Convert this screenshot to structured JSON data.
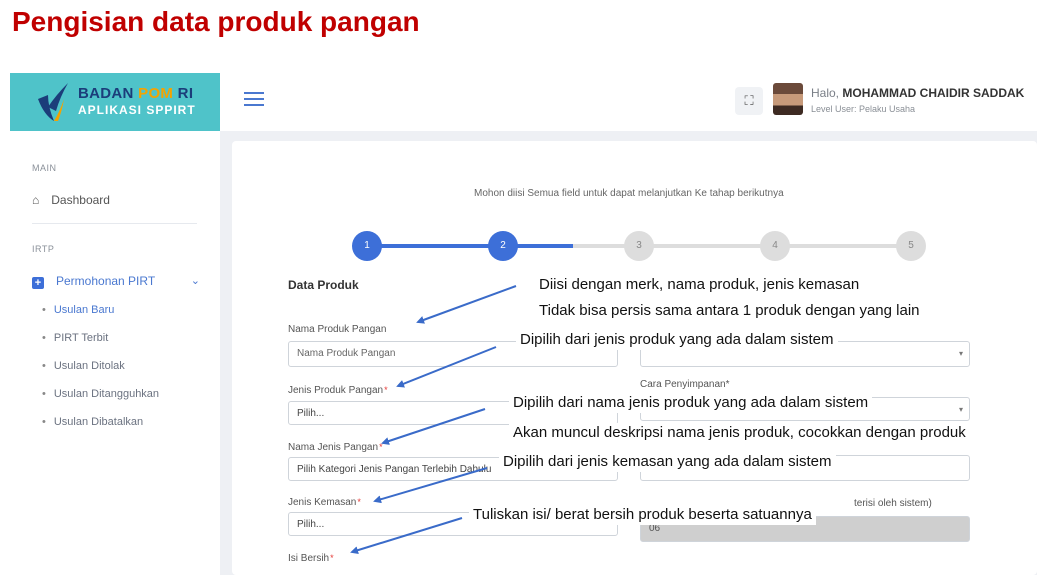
{
  "slide": {
    "title": "Pengisian data produk pangan"
  },
  "brand": {
    "name_main": "BADAN ",
    "name_accent": "POM",
    "name_end": " RI",
    "subtitle": "APLIKASI SPPIRT"
  },
  "topbar": {
    "greeting_prefix": "Halo, ",
    "user_name": "MOHAMMAD CHAIDIR SADDAK",
    "level": "Level User: Pelaku Usaha",
    "fullscreen_icon": "⛶"
  },
  "sidebar": {
    "section_main": "MAIN",
    "dashboard": "Dashboard",
    "section_irtp": "IRTP",
    "pirt_menu": "Permohonan PIRT",
    "submenu": [
      "Usulan Baru",
      "PIRT Terbit",
      "Usulan Ditolak",
      "Usulan Ditangguhkan",
      "Usulan Dibatalkan"
    ]
  },
  "form": {
    "notice": "Mohon diisi Semua field untuk dapat melanjutkan Ke tahap berikutnya",
    "steps": [
      "1",
      "2",
      "3",
      "4",
      "5"
    ],
    "active_step": 2,
    "section_title": "Data Produk",
    "labels": {
      "nama_produk": "Nama Produk Pangan",
      "jenis_produk": "Jenis Produk Pangan",
      "nama_jenis": "Nama Jenis Pangan",
      "jenis_kemasan": "Jenis Kemasan",
      "isi_bersih": "Isi Bersih",
      "cara_penyimpanan": "Cara Penyimpanan*",
      "terisi_sistem": "terisi oleh sistem)"
    },
    "values": {
      "nama_produk_placeholder": "Nama Produk Pangan",
      "jenis_produk": "Pilih...",
      "nama_jenis": "Pilih Kategori Jenis Pangan Terlebih Dahulu",
      "jenis_kemasan": "Pilih...",
      "kode_sistem": "06"
    }
  },
  "annotations": [
    "Diisi dengan merk, nama produk, jenis kemasan",
    "Tidak bisa persis sama antara 1 produk dengan yang lain",
    "Dipilih dari jenis produk yang ada dalam sistem",
    "Dipilih dari nama jenis produk yang ada dalam sistem",
    "Akan muncul deskripsi nama jenis produk, cocokkan dengan produk",
    "Dipilih dari jenis kemasan yang ada dalam sistem",
    "Tuliskan isi/ berat bersih produk beserta satuannya"
  ],
  "colors": {
    "title_red": "#c00000",
    "brand_teal": "#4fc3c9",
    "primary_blue": "#3d6fd8",
    "arrow_blue": "#3a6bc9"
  }
}
